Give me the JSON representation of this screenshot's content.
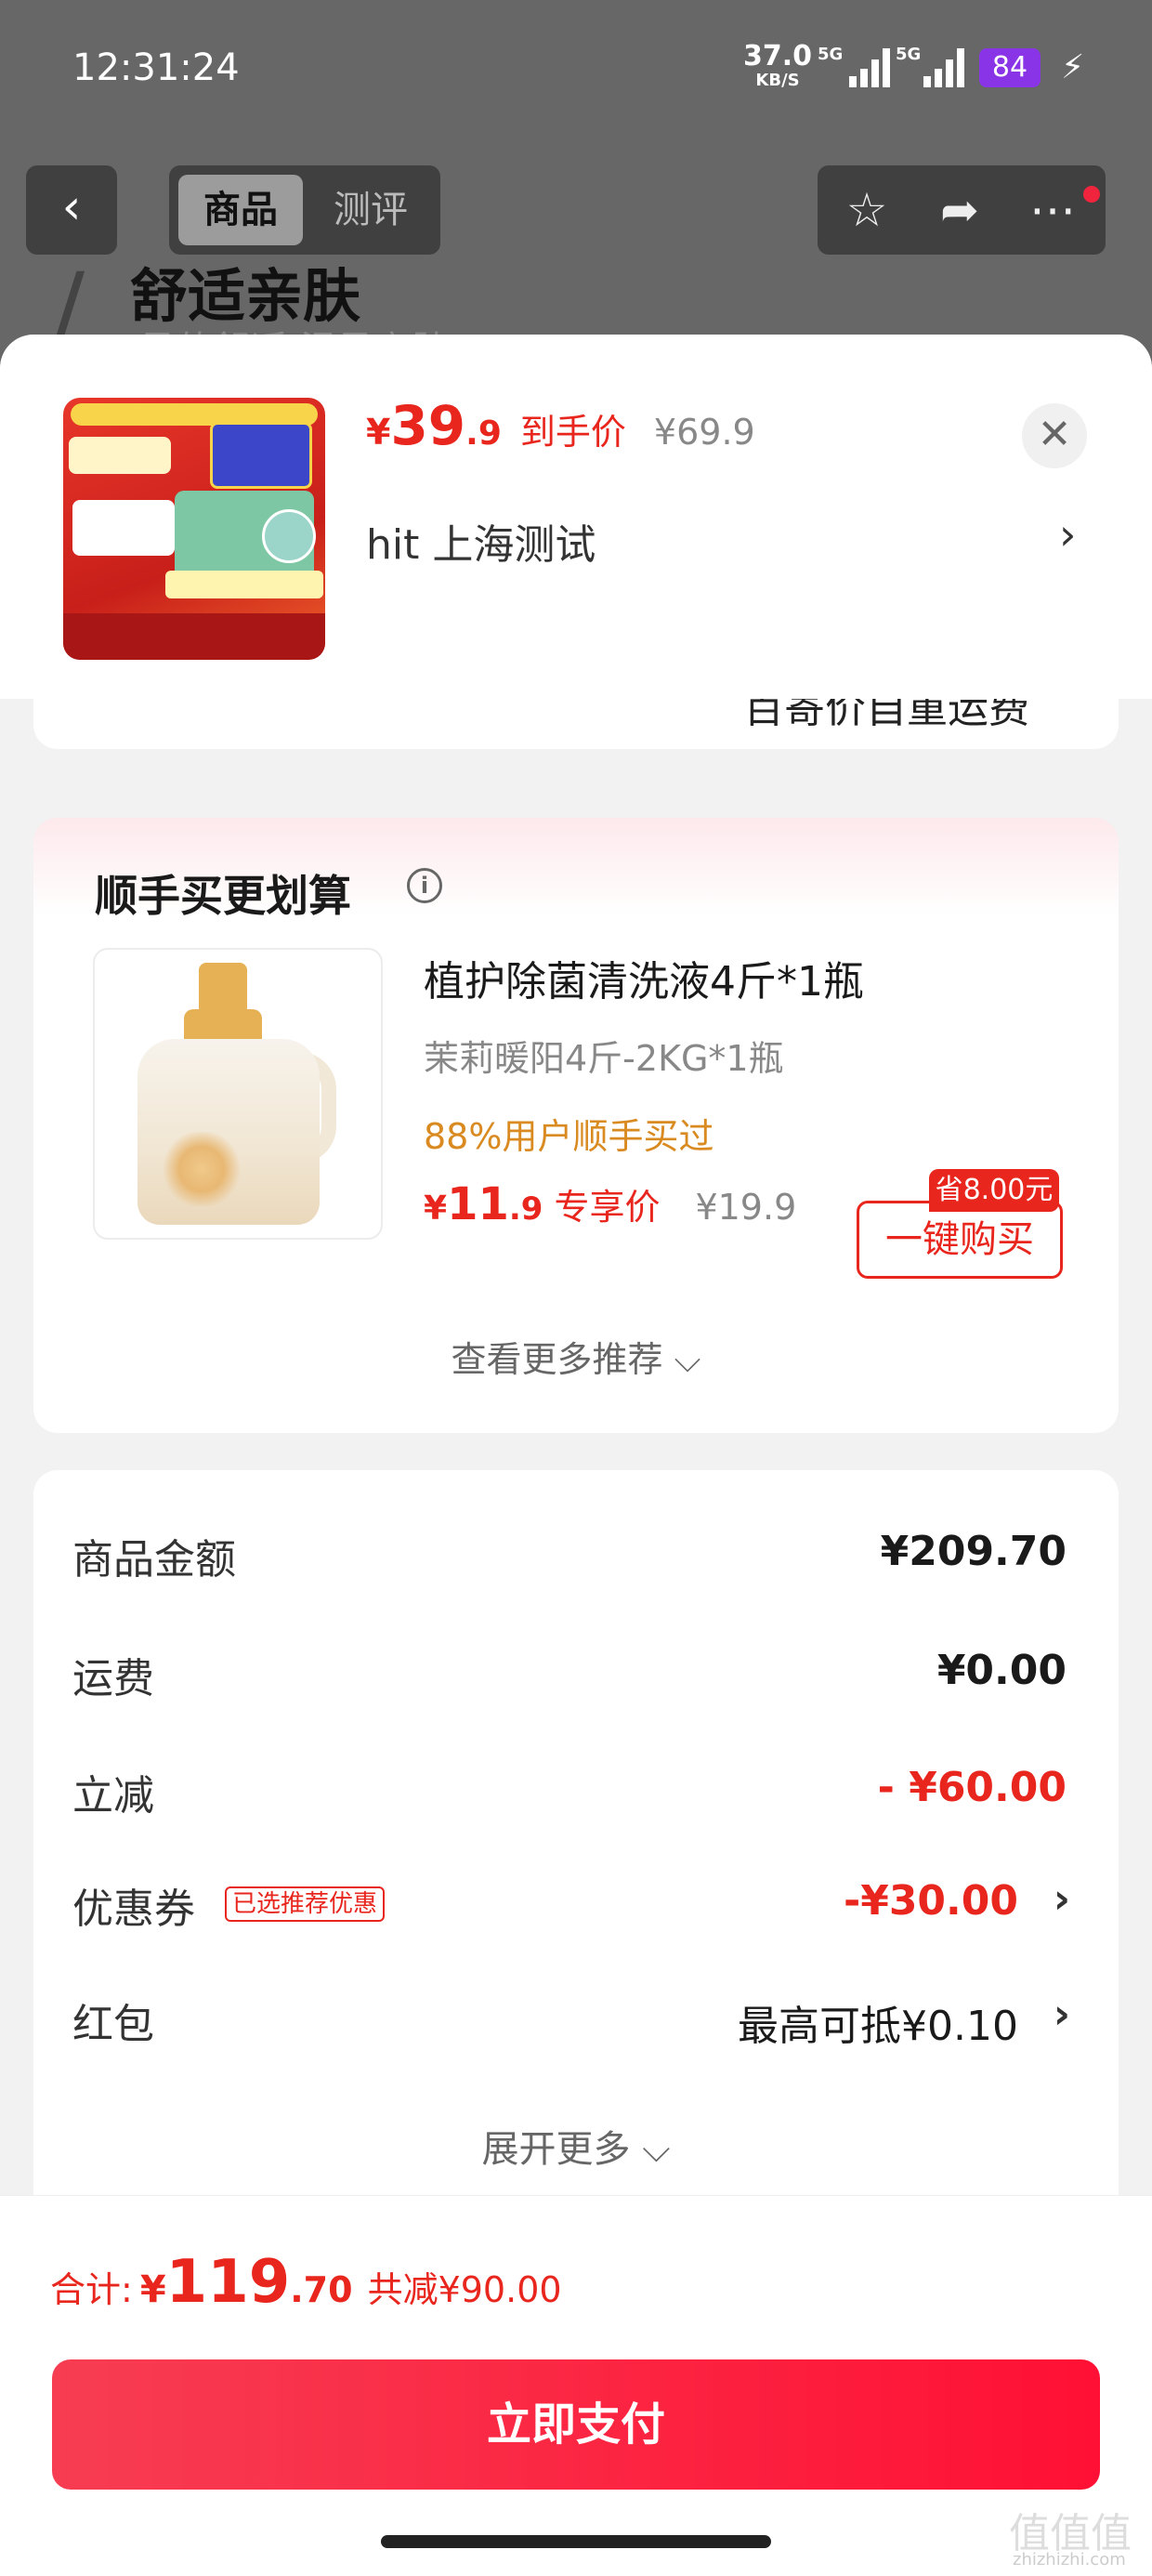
{
  "status_bar": {
    "time": "12:31:24",
    "net_speed": "37.0",
    "net_unit": "KB/S",
    "signal_1": "5G",
    "signal_2": "5G",
    "battery": "84",
    "battery_color": "#8a34e8"
  },
  "nav": {
    "tab_active": "商品",
    "tab_inactive": "测评"
  },
  "background_page": {
    "headline": "舒适亲肤",
    "subline": "柔软舒适 温柔亲肤"
  },
  "product_header": {
    "price_currency": "¥",
    "price_int": "39",
    "price_dec": ".9",
    "price_tag": "到手价",
    "original_price": "¥69.9",
    "address": "hit  上海测试",
    "close_icon": "close-icon"
  },
  "previous_card": {
    "text": "百寄价自重运费"
  },
  "recommend": {
    "title": "顺手买更划算",
    "product_name": "植护除菌清洗液4斤*1瓶",
    "spec": "茉莉暖阳4斤-2KG*1瓶",
    "social_proof": "88%用户顺手买过",
    "price_currency": "¥",
    "price_int": "11",
    "price_dec": ".9",
    "price_tag": "专享价",
    "original_price": "¥19.9",
    "save_badge": "省8.00元",
    "buy_button": "一键购买",
    "more_link": "查看更多推荐"
  },
  "summary": {
    "rows": [
      {
        "label": "商品金额",
        "value": "¥209.70"
      },
      {
        "label": "运费",
        "value": "¥0.00"
      },
      {
        "label": "立减",
        "value": "- ¥60.00"
      },
      {
        "label": "优惠券",
        "badge": "已选推荐优惠",
        "value": "-¥30.00"
      },
      {
        "label": "红包",
        "value": "最高可抵¥0.10"
      }
    ],
    "expand": "展开更多"
  },
  "footer": {
    "total_label": "合计:",
    "total_currency": "¥",
    "total_int": "119",
    "total_dec": ".70",
    "total_saved": "共减¥90.00",
    "pay_button": "立即支付"
  },
  "watermark": {
    "text": "值值值",
    "sub": "zhizhizhi.com"
  },
  "colors": {
    "accent_red": "#e8261d",
    "pay_gradient_start": "#f73d52",
    "pay_gradient_end": "#ff1034",
    "social_orange": "#d98a20"
  }
}
